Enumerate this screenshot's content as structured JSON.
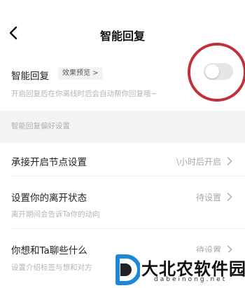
{
  "header": {
    "title": "智能回复"
  },
  "smart_reply": {
    "label": "智能回复",
    "preview_chip": "效果预览 >",
    "description": "开启回复后在你离线时后会自动帮你回复哦~",
    "toggle_on": false
  },
  "section": {
    "label": "智能回复偏好设置"
  },
  "rows": [
    {
      "title": "承接开启节点设置",
      "value": "\\小时后开启",
      "subtitle": ""
    },
    {
      "title": "设置你的离开状态",
      "value": "待设置",
      "subtitle": "离开期间会告诉Ta你的动向"
    },
    {
      "title": "你想和Ta聊些什么",
      "value": "待设置",
      "subtitle": "设置介绍标签与想和对方"
    }
  ],
  "watermark": {
    "text": "大北农软件园",
    "sub": "dabeinong.net"
  },
  "colors": {
    "annotation": "#c02f3a",
    "section_bg": "#f3f3f3",
    "toggle_off": "#e6e6e6"
  }
}
